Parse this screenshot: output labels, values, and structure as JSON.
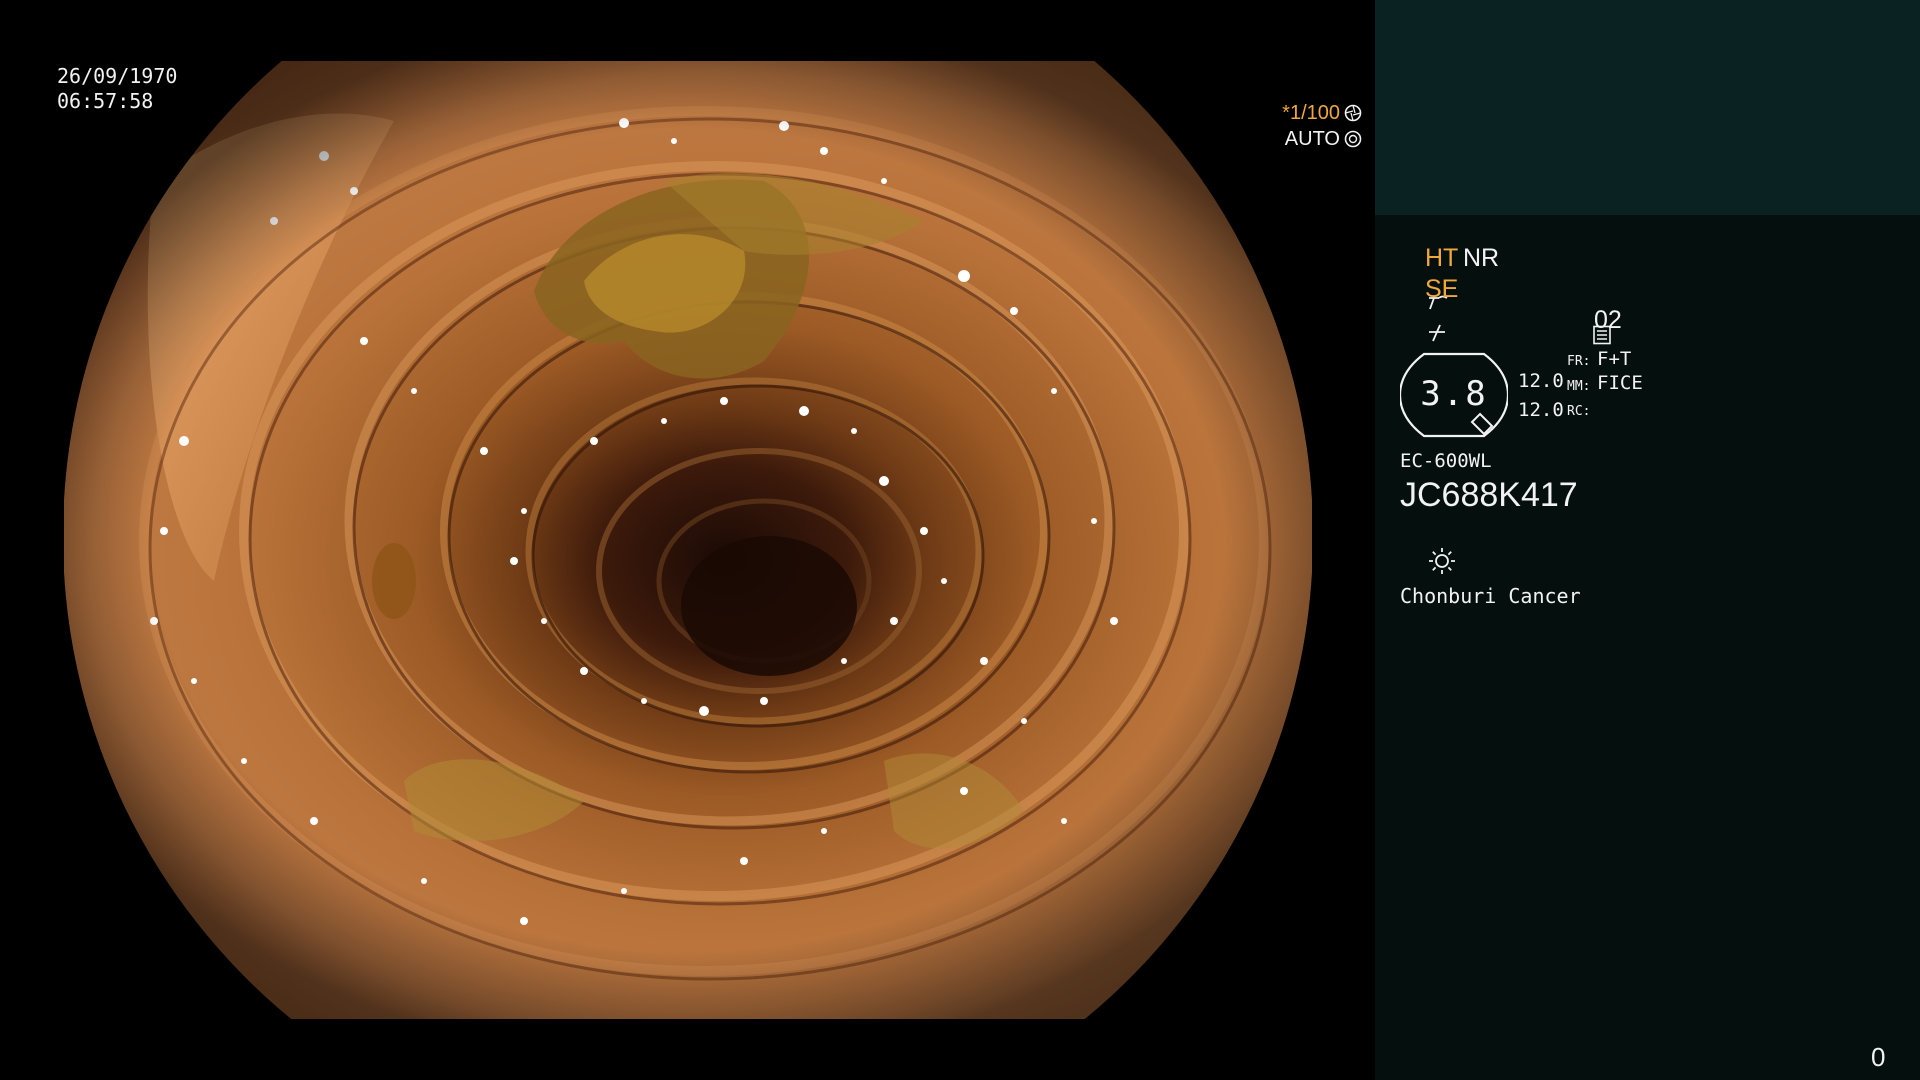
{
  "overlay": {
    "date": "26/09/1970",
    "time": "06:57:58",
    "shutter_speed": "*1/100",
    "iris_mode": "AUTO"
  },
  "panel": {
    "enhancement_ht": "HT",
    "enhancement_nr": "NR",
    "structure_se": "SE",
    "memory_slot": "02",
    "zoom": "3.8",
    "setting_1": "12.0",
    "setting_2": "12.0",
    "fr_label": "FR:",
    "fr_value": "F+T",
    "mm_label": "MM:",
    "mm_value": "FICE",
    "rc_label": "RC:",
    "scope_model": "EC-600WL",
    "scope_serial": "JC688K417",
    "institution": "Chonburi Cancer",
    "frame_counter": "0"
  },
  "colors": {
    "background": "#000000",
    "panel_bg": "#050f0e",
    "panel_top_bg": "#0b2223",
    "accent_orange": "#f0a83a",
    "text_white": "#f2f2f2"
  },
  "icons": {
    "shutter": "aperture-icon",
    "iris": "iris-icon",
    "structure": "structure-enhance-icon",
    "color": "color-enhance-icon",
    "memory": "memory-card-icon",
    "light": "light-source-icon"
  }
}
